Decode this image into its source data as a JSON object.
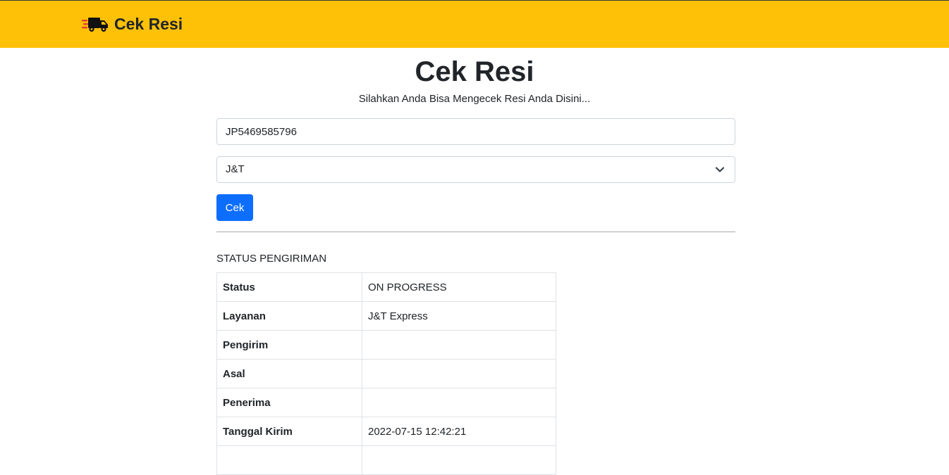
{
  "navbar": {
    "brand": "Cek Resi",
    "icon": "delivery-truck-icon",
    "background_color": "#ffc107"
  },
  "header": {
    "title": "Cek Resi",
    "subtitle": "Silahkan Anda Bisa Mengecek Resi Anda Disini..."
  },
  "form": {
    "resi_value": "JP5469585796",
    "courier_selected": "J&T",
    "submit_label": "Cek",
    "submit_color": "#0d6efd"
  },
  "status": {
    "heading": "STATUS PENGIRIMAN",
    "rows": [
      {
        "label": "Status",
        "value": "ON PROGRESS"
      },
      {
        "label": "Layanan",
        "value": "J&T Express"
      },
      {
        "label": "Pengirim",
        "value": ""
      },
      {
        "label": "Asal",
        "value": ""
      },
      {
        "label": "Penerima",
        "value": ""
      },
      {
        "label": "Tanggal Kirim",
        "value": "2022-07-15 12:42:21"
      },
      {
        "label": "",
        "value": ""
      }
    ]
  }
}
